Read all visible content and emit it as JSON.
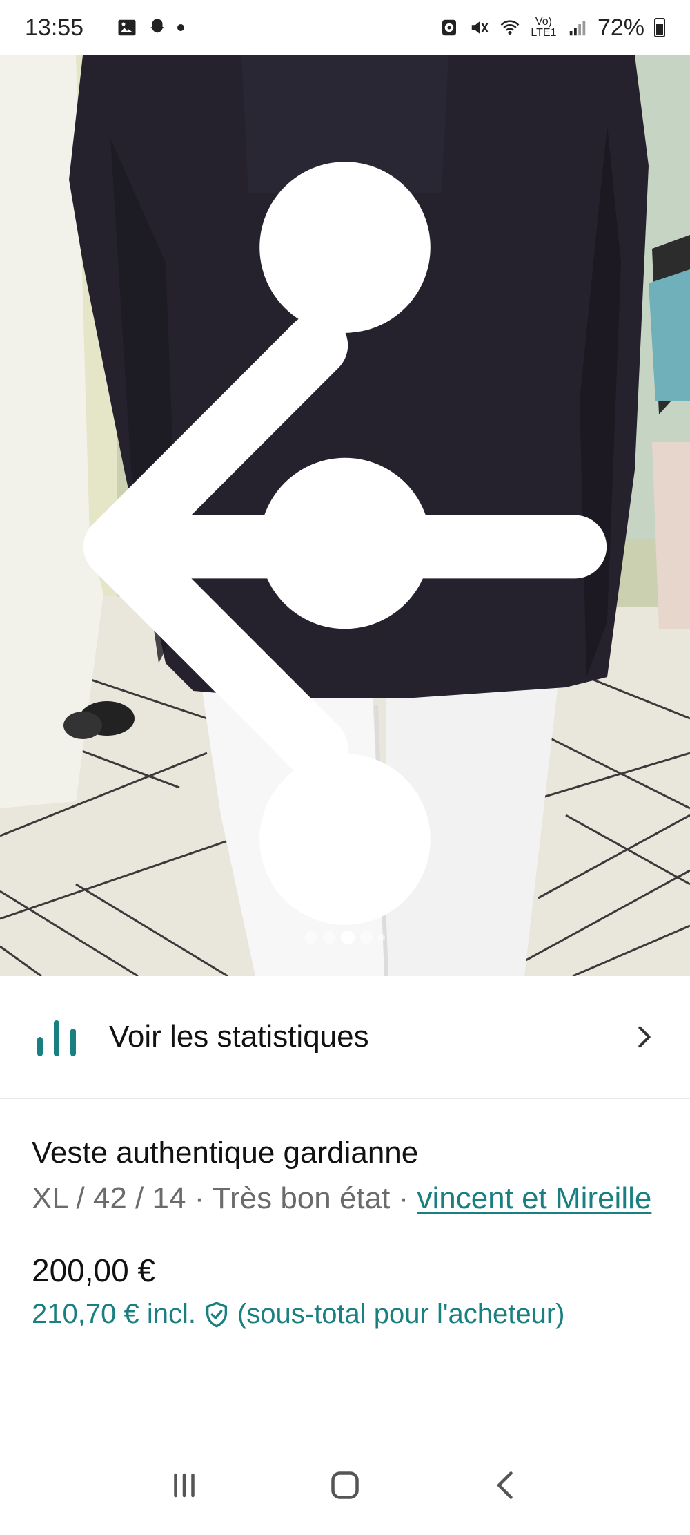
{
  "status_bar": {
    "time": "13:55",
    "battery": "72%",
    "left_icons": [
      "gallery-icon",
      "snapchat-icon",
      "dot-icon"
    ],
    "right_icons": [
      "alarm-icon",
      "mute-icon",
      "wifi-icon",
      "volte-icon",
      "signal-icon",
      "battery-icon"
    ],
    "network_label": "Vo) LTE1"
  },
  "photo": {
    "description_icons": [
      "back-arrow-icon",
      "more-vert-icon"
    ],
    "carousel_total": 5,
    "carousel_active": 3
  },
  "stats": {
    "label": "Voir les statistiques",
    "icon": "bar-chart-icon"
  },
  "item": {
    "title": "Veste authentique gardianne",
    "meta_prefix": "XL / 42 / 14 · Très bon état · ",
    "brand": "vincent et Mireille",
    "price": "200,00 €",
    "price_incl": "210,70 €  incl.",
    "price_incl_note": "(sous-total pour l'acheteur)"
  },
  "colors": {
    "accent": "#1a7f80",
    "text_primary": "#111111",
    "text_secondary": "#6b6b6b"
  }
}
